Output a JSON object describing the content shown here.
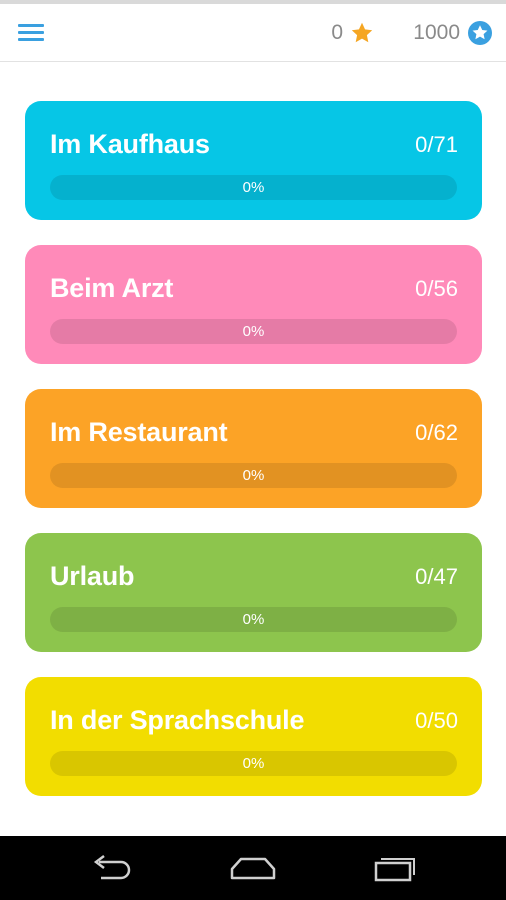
{
  "header": {
    "stars": "0",
    "points": "1000",
    "star_color": "#f5a623",
    "coin_color": "#3aa0e0",
    "menu_icon": "hamburger-menu-icon"
  },
  "categories": [
    {
      "title": "Im Kaufhaus",
      "count": "0/71",
      "progress_label": "0%",
      "progress": 0,
      "color": "#06c6e6"
    },
    {
      "title": "Beim Arzt",
      "count": "0/56",
      "progress_label": "0%",
      "progress": 0,
      "color": "#ff8ab9"
    },
    {
      "title": "Im Restaurant",
      "count": "0/62",
      "progress_label": "0%",
      "progress": 0,
      "color": "#fca326"
    },
    {
      "title": "Urlaub",
      "count": "0/47",
      "progress_label": "0%",
      "progress": 0,
      "color": "#8dc54d"
    },
    {
      "title": "In der Sprachschule",
      "count": "0/50",
      "progress_label": "0%",
      "progress": 0,
      "color": "#f2dd00"
    }
  ],
  "navbar": {
    "icons": [
      "back-icon",
      "home-icon",
      "recent-apps-icon"
    ]
  }
}
